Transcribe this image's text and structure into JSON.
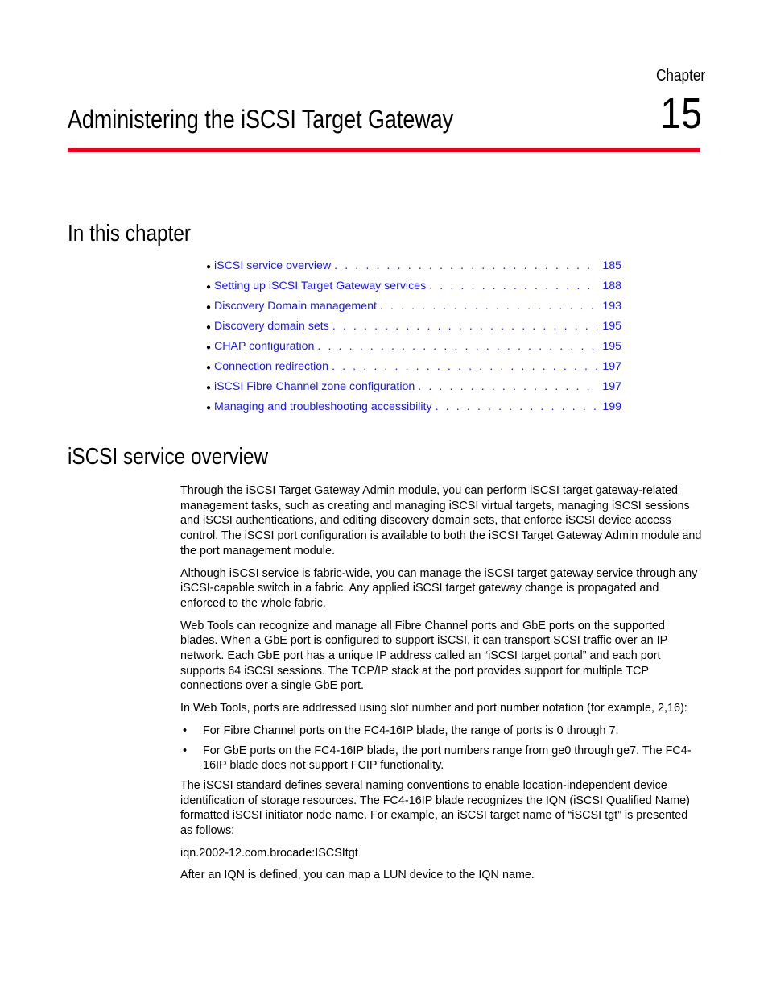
{
  "header": {
    "chapter_label": "Chapter",
    "chapter_number": "15",
    "title": "Administering the iSCSI Target Gateway",
    "accent_color": "#e8001c"
  },
  "in_this_chapter": {
    "heading": "In this chapter",
    "items": [
      {
        "label": "iSCSI service overview",
        "page": "185"
      },
      {
        "label": "Setting up iSCSI Target Gateway services",
        "page": "188"
      },
      {
        "label": "Discovery Domain management",
        "page": "193"
      },
      {
        "label": "Discovery domain sets",
        "page": "195"
      },
      {
        "label": "CHAP configuration",
        "page": "195"
      },
      {
        "label": "Connection redirection",
        "page": "197"
      },
      {
        "label": "iSCSI Fibre Channel zone configuration",
        "page": "197"
      },
      {
        "label": "Managing and troubleshooting accessibility",
        "page": "199"
      }
    ],
    "link_color": "#1a1adf"
  },
  "section": {
    "heading": "iSCSI service overview",
    "paragraphs": [
      "Through the iSCSI Target Gateway Admin module, you can perform iSCSI target gateway-related management tasks, such as creating and managing iSCSI virtual targets, managing iSCSI sessions and iSCSI authentications, and editing discovery domain sets, that enforce iSCSI device access control. The iSCSI port configuration is available to both the iSCSI Target Gateway Admin module and the port management module.",
      "Although iSCSI service is fabric-wide, you can manage the iSCSI target gateway service through any iSCSI-capable switch in a fabric. Any applied iSCSI target gateway change is propagated and enforced to the whole fabric.",
      "Web Tools can recognize and manage all Fibre Channel ports and GbE ports on the supported blades. When a GbE port is configured to support iSCSI, it can transport SCSI traffic over an IP network. Each GbE port has a unique IP address called an “iSCSI target portal” and each port supports 64 iSCSI sessions. The TCP/IP stack at the port provides support for multiple TCP connections over a single GbE port.",
      "In Web Tools, ports are addressed using slot number and port number notation (for example, 2,16):"
    ],
    "bullets": [
      "For Fibre Channel ports on the FC4-16IP blade, the range of ports is 0 through 7.",
      "For GbE ports on the FC4-16IP blade, the port numbers range from ge0 through ge7. The FC4-16IP blade does not support FCIP functionality."
    ],
    "paragraphs_after": [
      "The iSCSI standard defines several naming conventions to enable location-independent device identification of storage resources. The FC4-16IP blade recognizes the IQN (iSCSI Qualified Name) formatted iSCSI initiator node name. For example, an iSCSI target name of “iSCSI tgt” is presented as follows:",
      "iqn.2002-12.com.brocade:ISCSItgt",
      "After an IQN is defined, you can map a LUN device to the IQN name."
    ]
  }
}
